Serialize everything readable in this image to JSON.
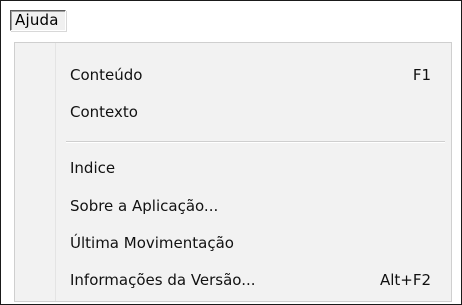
{
  "menubar": {
    "active_menu": "Ajuda"
  },
  "menu": {
    "items": [
      {
        "label": "Conteúdo",
        "shortcut": "F1"
      },
      {
        "label": "Contexto",
        "shortcut": ""
      },
      {
        "label": "Indice",
        "shortcut": ""
      },
      {
        "label": "Sobre a Aplicação...",
        "shortcut": ""
      },
      {
        "label": "Última Movimentação",
        "shortcut": ""
      },
      {
        "label": "Informações da Versão...",
        "shortcut": "Alt+F2"
      }
    ]
  }
}
